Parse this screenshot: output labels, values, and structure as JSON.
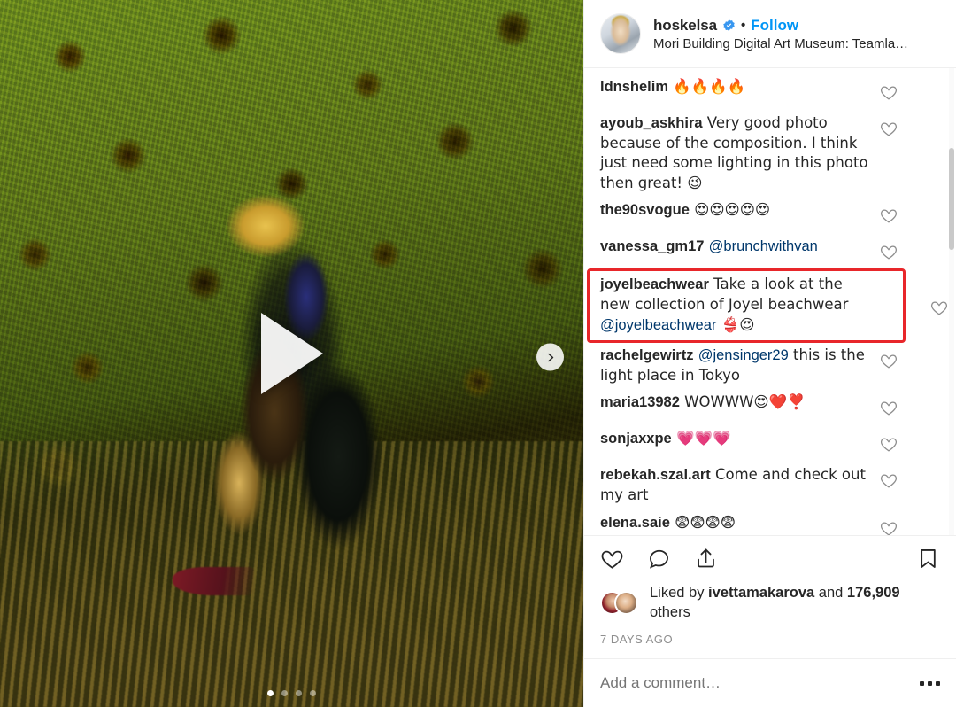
{
  "post": {
    "header": {
      "username": "hoskelsa",
      "verified_badge": "verified-icon",
      "separator": "•",
      "follow_label": "Follow",
      "location": "Mori Building Digital Art Museum: Teamla…"
    },
    "media": {
      "type": "video-carousel",
      "play_button": "play-icon",
      "next_button": "chevron-right-icon",
      "carousel_dots": 4,
      "active_dot_index": 0
    },
    "comments": [
      {
        "user": "ldnshelim",
        "text": " 🔥🔥🔥🔥",
        "mentions": [],
        "highlighted": false
      },
      {
        "user": "ayoub_askhira",
        "text": " Very good photo because of the composition. I think just need some lighting in this photo then great! 😉",
        "mentions": [],
        "highlighted": false
      },
      {
        "user": "the90svogue",
        "text": " 😍😍😍😍😍",
        "mentions": [],
        "highlighted": false
      },
      {
        "user": "vanessa_gm17",
        "text": " ",
        "mentions": [
          "@brunchwithvan"
        ],
        "highlighted": false
      },
      {
        "user": "joyelbeachwear",
        "text": " Take a look at the new collection of Joyel beachwear ",
        "mentions": [
          "@joyelbeachwear"
        ],
        "trailing": " 👙😍",
        "highlighted": true
      },
      {
        "user": "rachelgewirtz",
        "text": " ",
        "mentions": [
          "@jensinger29"
        ],
        "trailing": " this is the light place in Tokyo",
        "highlighted": false
      },
      {
        "user": "maria13982",
        "text": " WOWWW😍❤️❣️",
        "mentions": [],
        "highlighted": false
      },
      {
        "user": "sonjaxxpe",
        "text": " 💗💗💗",
        "mentions": [],
        "highlighted": false
      },
      {
        "user": "rebekah.szal.art",
        "text": " Come and check out my art",
        "mentions": [],
        "highlighted": false
      },
      {
        "user": "elena.saie",
        "text": " 😨😨😨😨",
        "mentions": [],
        "highlighted": false
      }
    ],
    "actions": {
      "like": "heart-icon",
      "comment": "speech-bubble-icon",
      "share": "share-icon",
      "save": "bookmark-icon"
    },
    "likes": {
      "prefix": "Liked by ",
      "user": "ivettamakarova",
      "middle": " and ",
      "count": "176,909",
      "suffix": " others"
    },
    "timestamp": "7 DAYS AGO",
    "add_comment": {
      "placeholder": "Add a comment…",
      "more_menu": "ellipsis-icon"
    }
  },
  "colors": {
    "link_blue": "#0095f6",
    "mention_blue": "#00376b",
    "text_primary": "#262626",
    "text_muted": "#8e8e8e",
    "highlight_red": "#e8262a"
  }
}
